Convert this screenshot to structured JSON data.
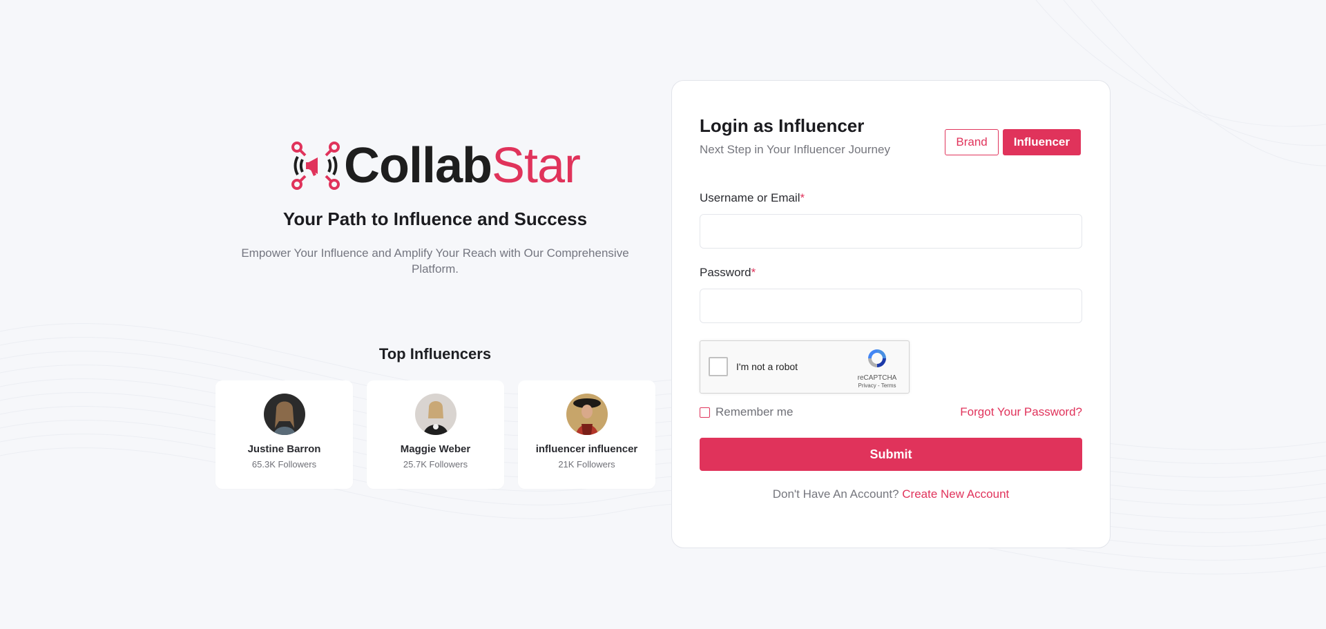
{
  "brand": {
    "logo_part1": "Collab",
    "logo_part2": "Star",
    "tagline": "Your Path to Influence and Success",
    "subtagline": "Empower Your Influence and Amplify Your Reach with Our Comprehensive Platform.",
    "accent_color": "#e0335b"
  },
  "top_influencers": {
    "title": "Top Influencers",
    "items": [
      {
        "name": "Justine Barron",
        "followers": "65.3K Followers",
        "avatar": "avatar-photo"
      },
      {
        "name": "Maggie Weber",
        "followers": "25.7K Followers",
        "avatar": "avatar-photo"
      },
      {
        "name": "influencer influencer",
        "followers": "21K Followers",
        "avatar": "avatar-photo"
      }
    ]
  },
  "login": {
    "title": "Login as Influencer",
    "subtitle": "Next Step in Your Influencer Journey",
    "toggle": {
      "brand_label": "Brand",
      "influencer_label": "Influencer",
      "selected": "Influencer"
    },
    "username_label": "Username or Email",
    "username_value": "",
    "password_label": "Password",
    "password_value": "",
    "required_mark": "*",
    "captcha": {
      "label": "I'm not a robot",
      "brand": "reCAPTCHA",
      "links": "Privacy - Terms",
      "checked": false
    },
    "remember_label": "Remember me",
    "remember_checked": false,
    "forgot_label": "Forgot Your Password?",
    "submit_label": "Submit",
    "signup_prompt": "Don't Have An Account?",
    "signup_link": "Create New Account"
  }
}
